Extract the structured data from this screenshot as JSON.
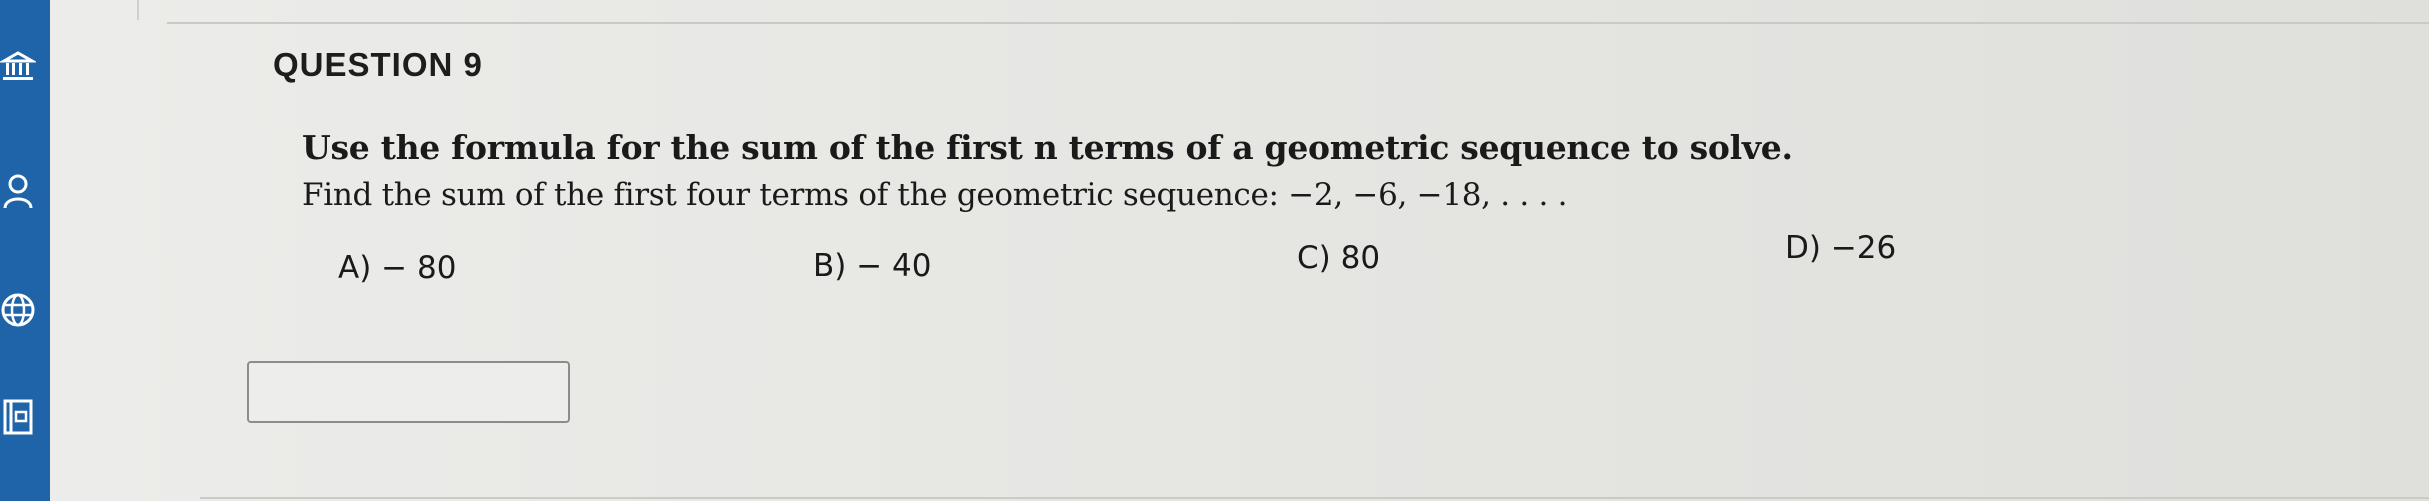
{
  "nav": {
    "items": [
      {
        "icon": "institution-icon"
      },
      {
        "icon": "account-icon"
      },
      {
        "icon": "globe-icon"
      },
      {
        "icon": "content-icon"
      }
    ],
    "background": "#1f64a8"
  },
  "question": {
    "title": "QUESTION 9",
    "line1": "Use the formula for the sum of the first n terms of a geometric sequence to solve.",
    "line2": "Find the sum of the first four terms of the geometric sequence: −2, −6, −18, . . . .",
    "choices": [
      {
        "label": "A) − 80"
      },
      {
        "label": "B) − 40"
      },
      {
        "label": "C) 80"
      },
      {
        "label": "D) −26"
      }
    ]
  },
  "answer": {
    "value": ""
  }
}
